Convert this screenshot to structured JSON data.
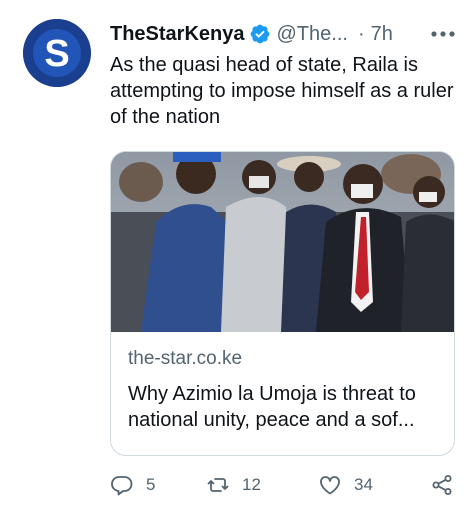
{
  "tweet": {
    "author_name": "TheStarKenya",
    "handle": "@The...",
    "time": "7h",
    "separator": "·",
    "text": "As the quasi head of state, Raila is attempting to impose himself as a ruler of the nation",
    "avatar_letter": "S",
    "card": {
      "domain": "the-star.co.ke",
      "title": "Why Azimio la Umoja is threat to national unity, peace and a sof..."
    },
    "actions": {
      "replies": "5",
      "retweets": "12",
      "likes": "34"
    }
  },
  "colors": {
    "avatar_bg": "#1a3f8f",
    "verified": "#1d9bf0",
    "secondary_text": "#536471"
  },
  "icons": [
    "verified-badge-icon",
    "more-options-icon",
    "reply-icon",
    "retweet-icon",
    "like-icon",
    "share-icon"
  ]
}
